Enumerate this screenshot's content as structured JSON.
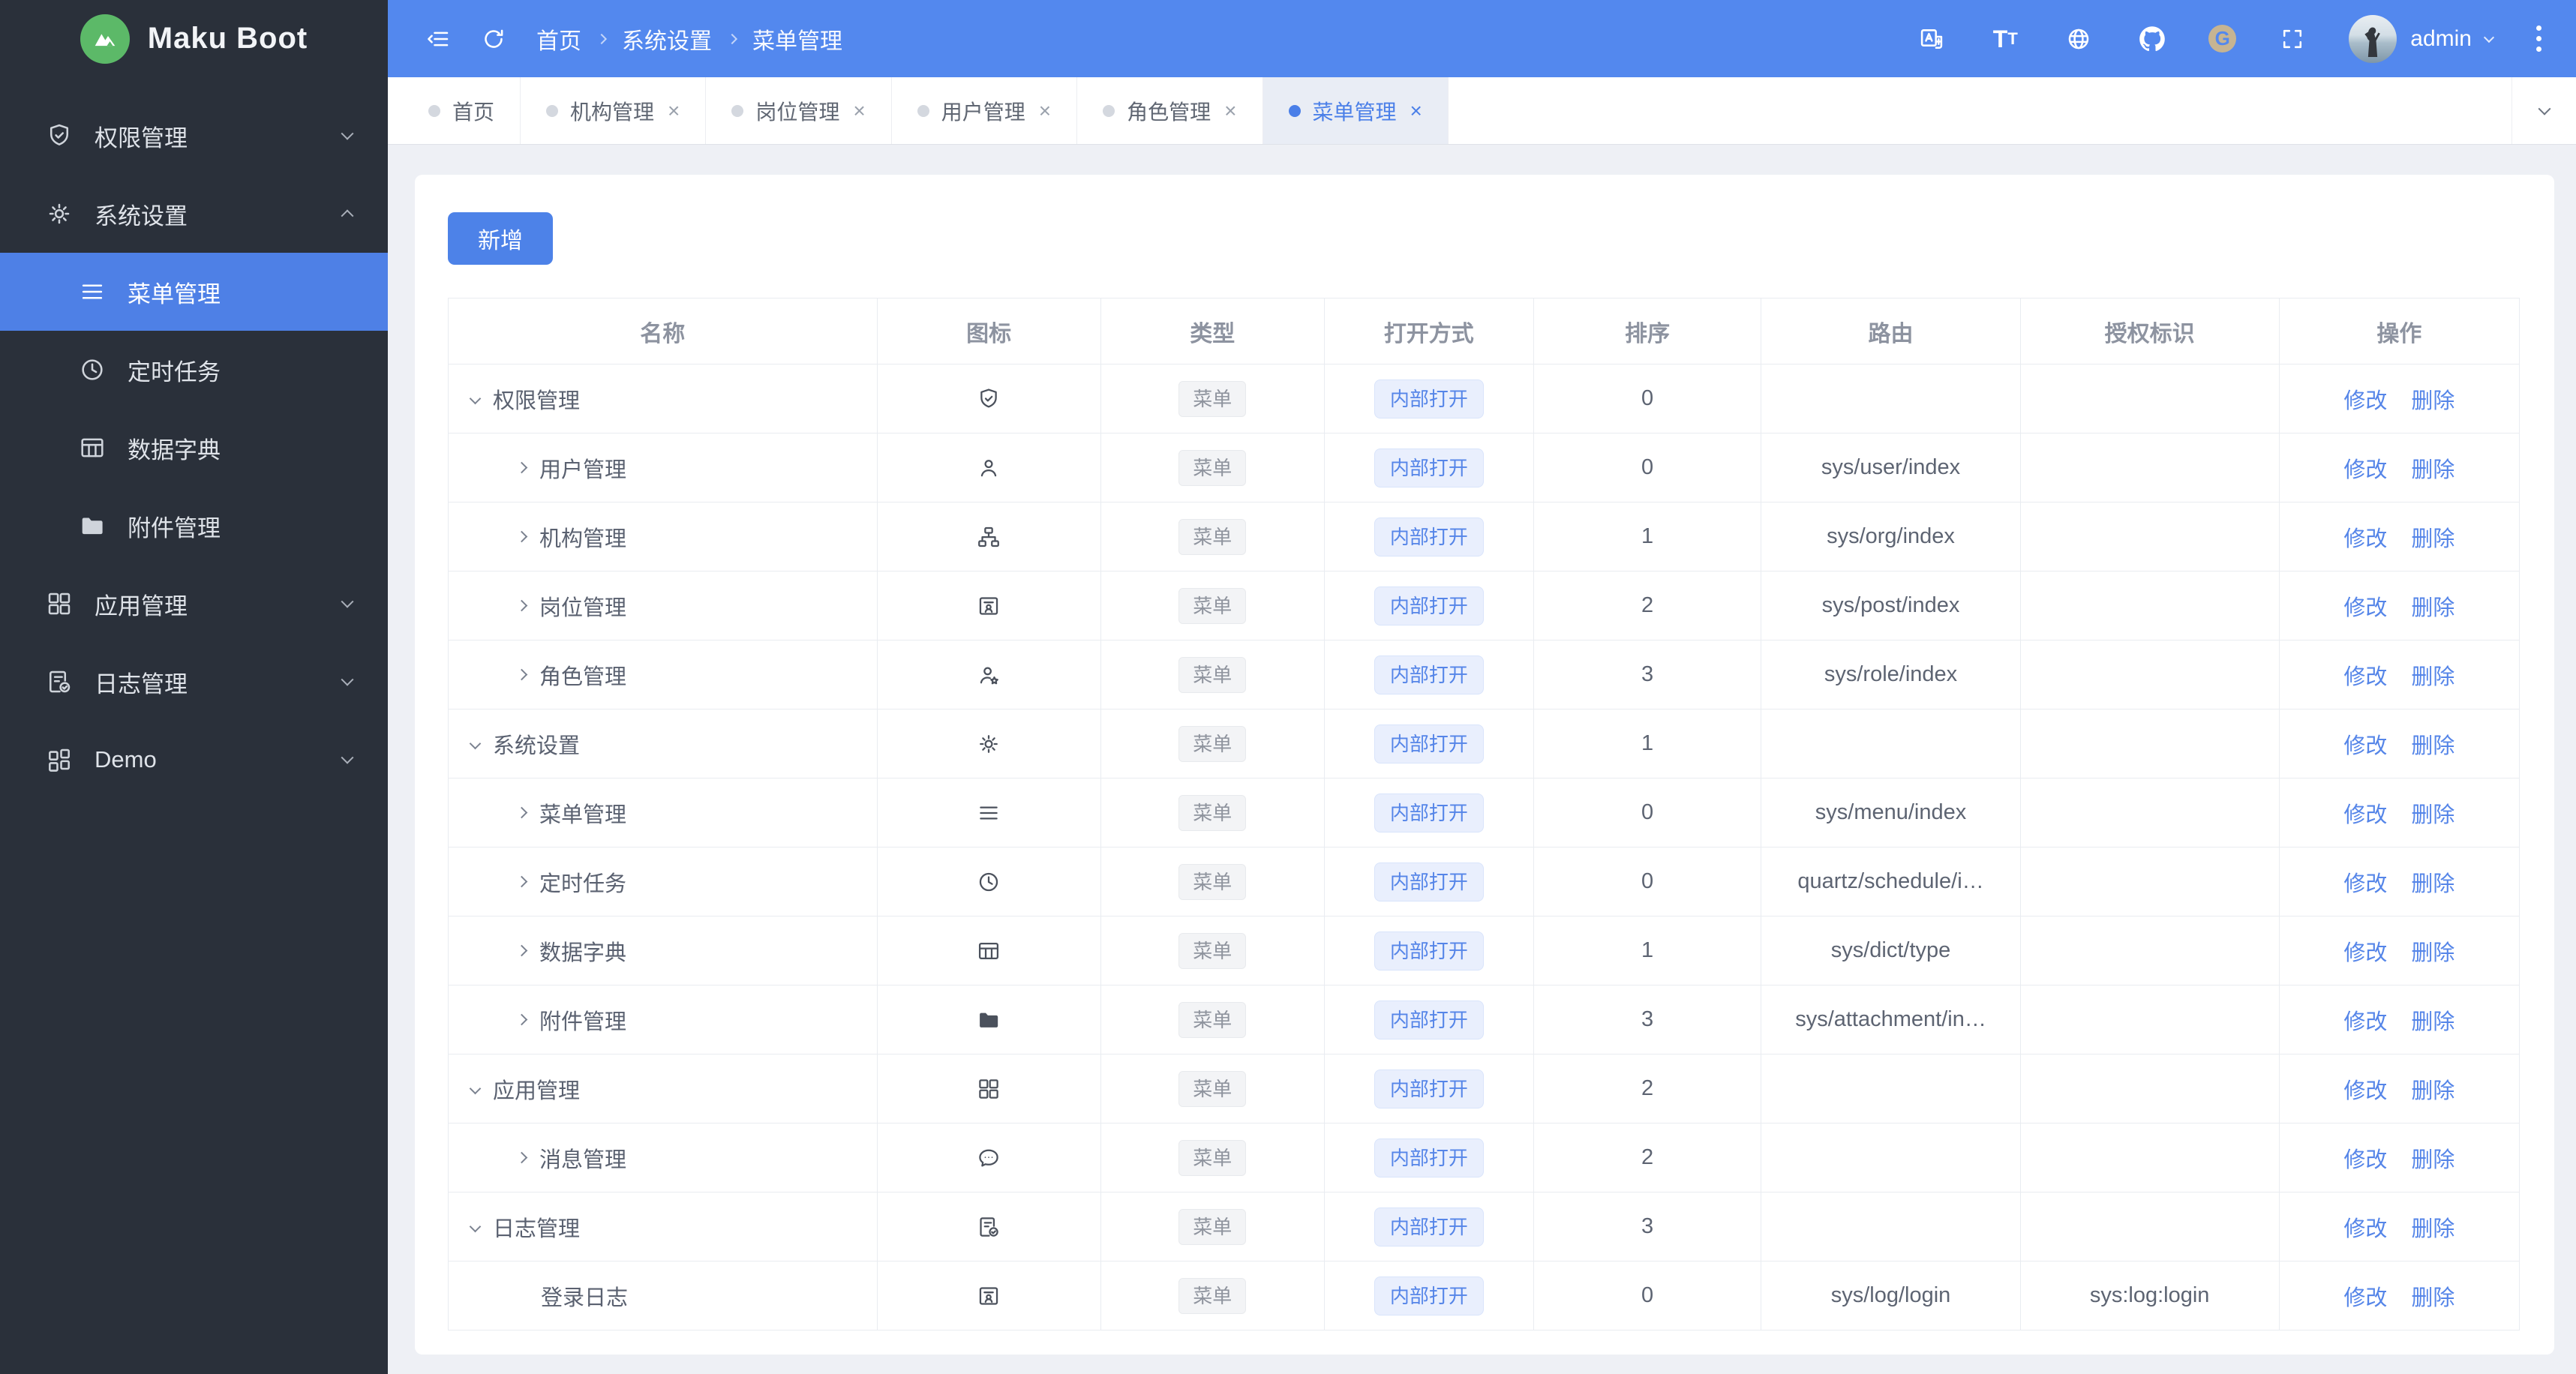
{
  "app": {
    "name": "Maku Boot",
    "logo_icon": "mountain-icon"
  },
  "colors": {
    "topbar": "#5388ee",
    "sidebar": "#2a303a",
    "sidebar_active": "#4e80e6",
    "accent_button": "#4d82e8",
    "link": "#5585e8",
    "page_background": "#eef0f5"
  },
  "topbar": {
    "left_icons": [
      "fold",
      "refresh"
    ],
    "breadcrumb": [
      "首页",
      "系统设置",
      "菜单管理"
    ],
    "right_icons": [
      "language",
      "font-size",
      "globe",
      "github",
      "gitee",
      "fullscreen"
    ],
    "gitee_letter": "G",
    "user": "admin"
  },
  "sidebar": {
    "items": [
      {
        "label": "权限管理",
        "icon": "shield-check",
        "chevron": "down"
      },
      {
        "label": "系统设置",
        "icon": "gear",
        "chevron": "up",
        "expanded": true,
        "children": [
          {
            "label": "菜单管理",
            "icon": "menu-lines",
            "active": true
          },
          {
            "label": "定时任务",
            "icon": "clock"
          },
          {
            "label": "数据字典",
            "icon": "table-grid"
          },
          {
            "label": "附件管理",
            "icon": "folder"
          }
        ]
      },
      {
        "label": "应用管理",
        "icon": "grid",
        "chevron": "down"
      },
      {
        "label": "日志管理",
        "icon": "doc-check",
        "chevron": "down"
      },
      {
        "label": "Demo",
        "icon": "grid-alt",
        "chevron": "down"
      }
    ]
  },
  "tabs": [
    {
      "label": "首页",
      "closable": false,
      "active": false
    },
    {
      "label": "机构管理",
      "closable": true,
      "active": false
    },
    {
      "label": "岗位管理",
      "closable": true,
      "active": false
    },
    {
      "label": "用户管理",
      "closable": true,
      "active": false
    },
    {
      "label": "角色管理",
      "closable": true,
      "active": false
    },
    {
      "label": "菜单管理",
      "closable": true,
      "active": true
    }
  ],
  "toolbar": {
    "add_label": "新增"
  },
  "table": {
    "columns": [
      "名称",
      "图标",
      "类型",
      "打开方式",
      "排序",
      "路由",
      "授权标识",
      "操作"
    ],
    "column_widths": [
      "20.7%",
      "10.8%",
      "10.8%",
      "10.1%",
      "11%",
      "12.5%",
      "12.5%",
      "11.6%"
    ],
    "type_label": "菜单",
    "open_label": "内部打开",
    "action_labels": [
      "修改",
      "删除"
    ],
    "rows": [
      {
        "name": "权限管理",
        "icon": "shield-check",
        "expand": "down",
        "level": 0,
        "sort": "0",
        "route": "",
        "auth": ""
      },
      {
        "name": "用户管理",
        "icon": "user",
        "expand": "right",
        "level": 1,
        "sort": "0",
        "route": "sys/user/index",
        "auth": ""
      },
      {
        "name": "机构管理",
        "icon": "org",
        "expand": "right",
        "level": 1,
        "sort": "1",
        "route": "sys/org/index",
        "auth": ""
      },
      {
        "name": "岗位管理",
        "icon": "id-card",
        "expand": "right",
        "level": 1,
        "sort": "2",
        "route": "sys/post/index",
        "auth": ""
      },
      {
        "name": "角色管理",
        "icon": "user-star",
        "expand": "right",
        "level": 1,
        "sort": "3",
        "route": "sys/role/index",
        "auth": ""
      },
      {
        "name": "系统设置",
        "icon": "gear",
        "expand": "down",
        "level": 0,
        "sort": "1",
        "route": "",
        "auth": ""
      },
      {
        "name": "菜单管理",
        "icon": "menu-lines",
        "expand": "right",
        "level": 1,
        "sort": "0",
        "route": "sys/menu/index",
        "auth": ""
      },
      {
        "name": "定时任务",
        "icon": "clock",
        "expand": "right",
        "level": 1,
        "sort": "0",
        "route": "quartz/schedule/i…",
        "auth": ""
      },
      {
        "name": "数据字典",
        "icon": "table-grid",
        "expand": "right",
        "level": 1,
        "sort": "1",
        "route": "sys/dict/type",
        "auth": ""
      },
      {
        "name": "附件管理",
        "icon": "folder",
        "expand": "right",
        "level": 1,
        "sort": "3",
        "route": "sys/attachment/in…",
        "auth": ""
      },
      {
        "name": "应用管理",
        "icon": "grid",
        "expand": "down",
        "level": 0,
        "sort": "2",
        "route": "",
        "auth": ""
      },
      {
        "name": "消息管理",
        "icon": "chat",
        "expand": "right",
        "level": 1,
        "sort": "2",
        "route": "",
        "auth": ""
      },
      {
        "name": "日志管理",
        "icon": "doc-check",
        "expand": "down",
        "level": 0,
        "sort": "3",
        "route": "",
        "auth": ""
      },
      {
        "name": "登录日志",
        "icon": "id-card",
        "expand": "none",
        "level": 1,
        "sort": "0",
        "route": "sys/log/login",
        "auth": "sys:log:login"
      }
    ]
  }
}
